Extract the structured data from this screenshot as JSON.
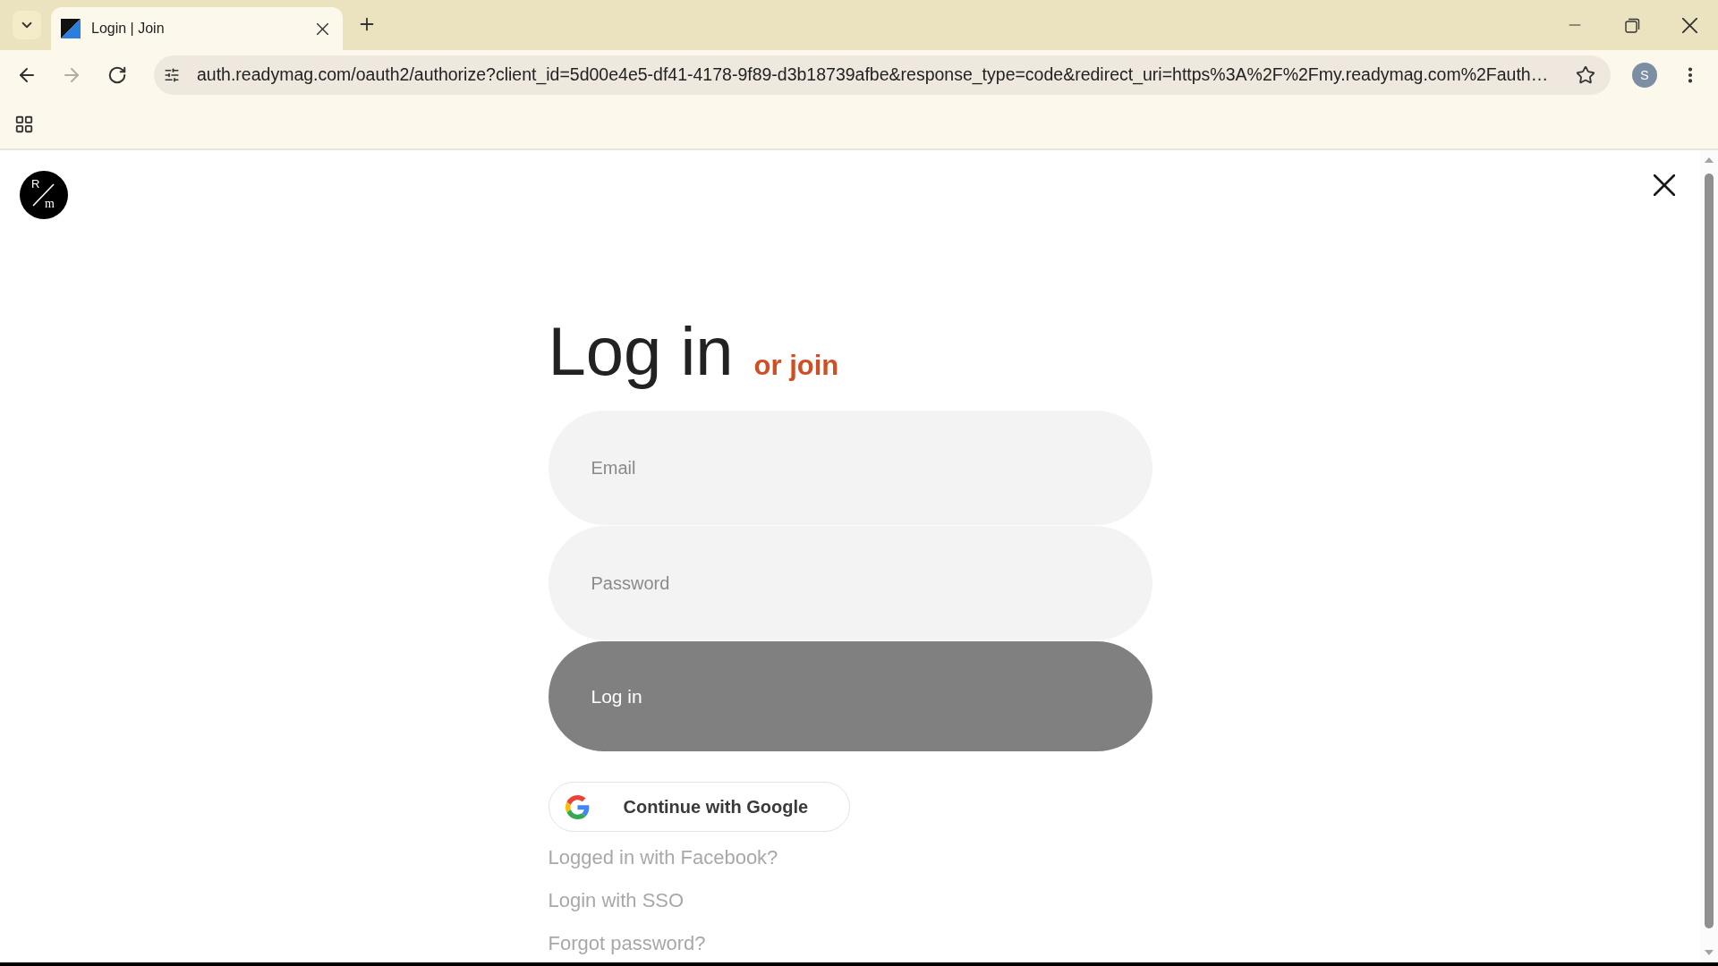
{
  "browser": {
    "tabs": [
      {
        "title": "Login | Join",
        "selected": true
      }
    ],
    "address": "auth.readymag.com/oauth2/authorize?client_id=5d00e4e5-df41-4178-9f89-d3b18739afbe&response_type=code&redirect_uri=https%3A%2F%2Fmy.readymag.com%2Fauth…",
    "profile_initial": "S"
  },
  "page": {
    "logo": {
      "upper": "R",
      "lower": "m"
    },
    "title": "Log in",
    "join_link": "or join",
    "fields": [
      {
        "placeholder": "Email"
      },
      {
        "placeholder": "Password"
      }
    ],
    "submit_button": "Log in",
    "google_button": "Continue with Google",
    "links": [
      "Logged in with Facebook?",
      "Login with SSO",
      "Forgot password?"
    ]
  }
}
